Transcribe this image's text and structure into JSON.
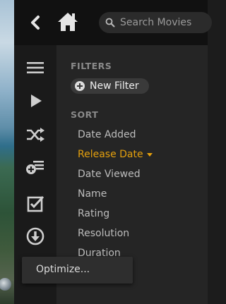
{
  "search": {
    "placeholder": "Search Movies"
  },
  "filters": {
    "heading": "FILTERS",
    "new_filter_label": "New Filter"
  },
  "sort": {
    "heading": "SORT",
    "items": [
      {
        "label": "Date Added"
      },
      {
        "label": "Release Date",
        "active": true
      },
      {
        "label": "Date Viewed"
      },
      {
        "label": "Name"
      },
      {
        "label": "Rating"
      },
      {
        "label": "Resolution"
      },
      {
        "label": "Duration"
      }
    ]
  },
  "popup": {
    "item_label": "Optimize..."
  },
  "sidebar": {
    "icons": [
      "menu-icon",
      "play-icon",
      "shuffle-icon",
      "add-playlist-icon",
      "checkbox-icon",
      "download-icon"
    ]
  },
  "colors": {
    "accent": "#e5a00d",
    "background": "#252525",
    "topbar": "#111111"
  }
}
